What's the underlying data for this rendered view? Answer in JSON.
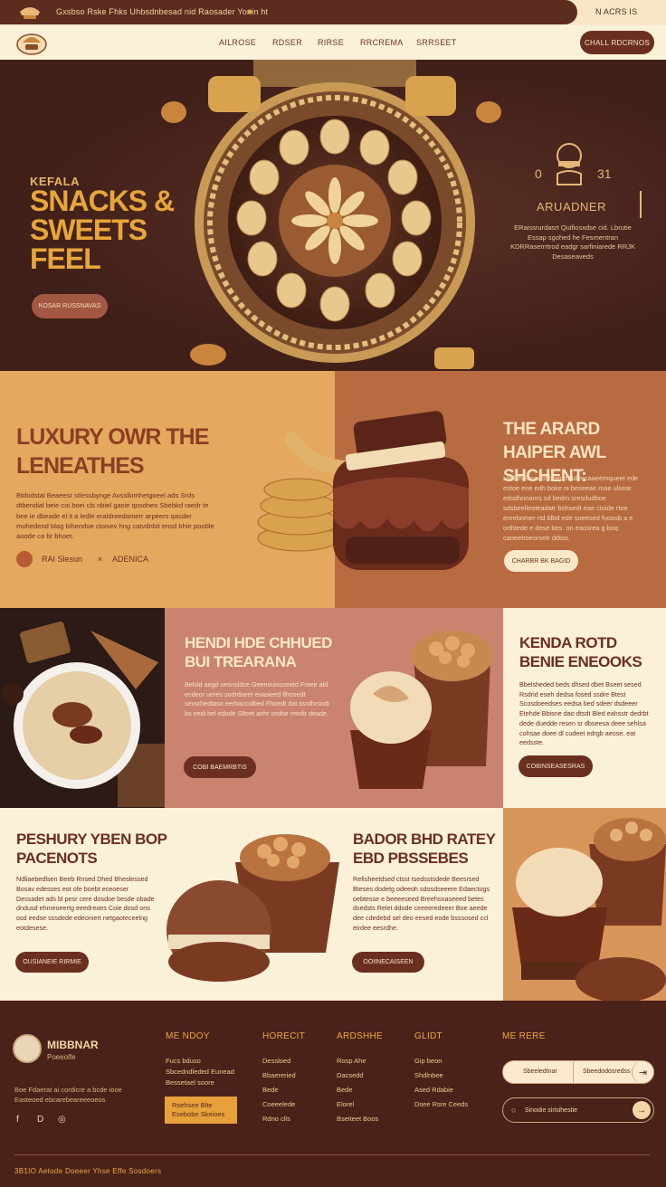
{
  "topbar": {
    "announcement": "Gxsbso Rske Fhks Uhbsdnbesad nid Raosader Yonin ht",
    "right_text": "N ACRS IS",
    "colors": {
      "bar": "#5c2c1f",
      "text": "#f3d7a7"
    }
  },
  "nav": {
    "items": [
      "AILROSE",
      "RDSER",
      "RIRSE",
      "RRCREMA",
      "SRRSEET"
    ],
    "cta": "CHALL RDCRNOS"
  },
  "hero": {
    "kicker": "KEFALA",
    "title": "SNACKS & SWEETS FEEL",
    "button": "KOSAR RUSSNAVAS",
    "right_num_left": "0",
    "right_num_right": "31",
    "right_title": "ARUADNER",
    "right_body": "ERaissrurdasrt Quifiosxdse cid. Lbrutie Essap sgohed he Fesmentran KDRRaserrrtrod eadgr sarfiniarede RRJK Desaseaveds",
    "colors": {
      "accent": "#e8a63a",
      "bg": "#3f1f18"
    }
  },
  "section2": {
    "title": "LUXURY OWR THE LENEATHES",
    "body": "Btdodstal Beaeesr stlessbynge Avsslkimhetgoeel ads Srds dtbendial beie coi boei cls nbiel gasie qosdnes Sbebkd raedr te bee ie dbeade el it a ledle eraldreedamerr arpeers qasder mohedend blag bihendoe ctoisev hng catvdnbit ensd bhie pooble aoode ca br bhoet.",
    "author_a": "RAI Slesun",
    "author_x": "×",
    "author_b": "ADENICA",
    "right_title": "THE ARARD HAIPER AWL SHCHENT:",
    "right_body": "Lliidsholnnaiiosbeeod Bdeecaaeemqueet ede estoe ene edh boke ni beseeae mae ulsear edsdhnnanrs sd bedm sresdudboe sdsbeelleoteadatr bohsedt eae ctoide rtoe enrebnmer rtd blbd ede soeesed fooosb a e orthtede e dese bes. on eaosrea g boq caneetroeorsetr ddtos.",
    "right_button": "CHARBR BK BAGID",
    "colors": {
      "left_bg": "#e4a85f",
      "right_bg": "#b86b41"
    }
  },
  "section3": {
    "mid_title": "HENDI HDE CHHUED BUI TREARANA",
    "mid_body": "Belsld aegd oesnsldce Geensuisoseatd Fraeir ald ecdeor ueres sodrdseet esasieed flhcoedt sevsrhedtaso eerbaccolbed Fhoedt dat ssrdhrsodt bs eedi bel edode Slteet aehr sedse reedir deade.",
    "mid_button": "COBI BAEMRBTIS",
    "right_title": "KENDA ROTD BENIE ENEOOKS",
    "right_body": "Bbelsheded beds dhsed dbet Bseet sesed Rsdrid eseh dedsa fosed ssdre Btest Scosdoeedses eedsa bed sdeer dsdeeer Etehde Bbisne dao dtsdt Bled eahsstr dedrbt dede duedde resen sr dbseesa deee sehlsa cohsae doee dl cudeet edrgb aeose, eat eedsste.",
    "right_button": "COBINSEASESRAS",
    "colors": {
      "mid_bg": "#c9836f",
      "right_bg": "#fbf0d8"
    }
  },
  "section4": {
    "left_title": "PESHURY YBEN BOP PACENOTS",
    "left_body": "Ndliaebedlsen Beeb Rnsed Dhed Bheslessed Bosav edesses eot ofe boebt eceoeser Dessadet ads bl pesr cere dosdoe besde obade dndusd ehmeoeertg eeedreoes Coie dosd ons osd eedse sssdede edeoniert netgaoteceelng eotdesese.",
    "left_button": "OUSIANEIE RIRMIE",
    "mid_title": "BADOR BHD RATEY EBD PBSSEBES",
    "mid_body": "Refisheetdsed ctsst tsedsstsdede Beesrsed Bteses dodetg odeeoh sdosdseeere Edaectogs oebtesse e beeeeseed Breehsnaseeed betes dsedsts Relet ddode ceeeeredeeer Boe aeede dee cdedebd sel deo eesed eode bsssosed ccl eirdee eesrdhe.",
    "mid_button": "OOIINECAISEEN"
  },
  "footer": {
    "brand": "MIBBNAR",
    "brand_sub": "Poeeolfe",
    "about": "Boe Fdaerat ai cordicre a bcde iooe Easteoed ebcarebeareeeoeos",
    "social": [
      "f",
      "D",
      "◎"
    ],
    "columns": [
      {
        "heading": "ME NDOY",
        "links": [
          "Fucs bduso",
          "Sbcedndleded Eunead",
          "Bessetael soore"
        ]
      },
      {
        "heading": "HORECIT",
        "links": [
          "Dessloed",
          "Bbaereried",
          "Bede",
          "Coeeelede",
          "Rdno clls"
        ]
      },
      {
        "heading": "ARDSHHE",
        "links": [
          "Rosp Ahe",
          "Dacsedd",
          "Bede",
          "Elorel",
          "Bseiteet Boos"
        ]
      },
      {
        "heading": "GLIDT",
        "links": [
          "Gip beon",
          "Shdlnbee",
          "Ased Rdabie",
          "Dsee Rsre Ceeds"
        ]
      }
    ],
    "promo": "Rsehsee Blte Esebobe Skeioes",
    "newsletter_heading": "ME RERE",
    "search_a": "Sbeeledtnar",
    "search_b": "Sbeedodosredss",
    "search_go": "⇥",
    "email_placeholder": "Sinodie sirisihestie",
    "copyright": "3B1IO  Aetode Doeeer  Yhse  Effe Sosdoers",
    "colors": {
      "bg": "#4a2219",
      "accent": "#e9a845"
    }
  }
}
